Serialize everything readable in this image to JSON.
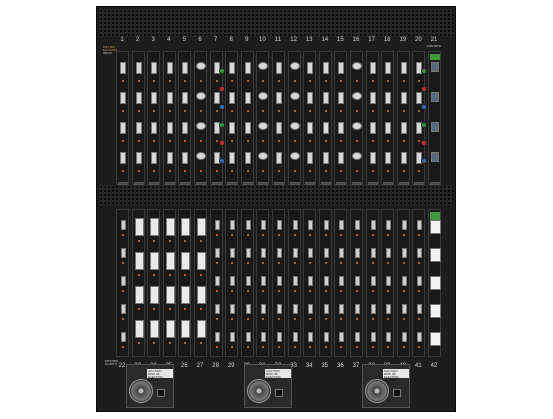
{
  "chassis": {
    "title_lines": [
      "MATRIX",
      "MTX2000"
    ],
    "top_section_label": "INPUT",
    "bottom_section_label": "OUTPUT",
    "top_slots": [
      "1",
      "2",
      "3",
      "4",
      "5",
      "6",
      "7",
      "8",
      "9",
      "10",
      "11",
      "12",
      "13",
      "14",
      "15",
      "16",
      "17",
      "18",
      "19",
      "20",
      "21"
    ],
    "top_slot_caption": "CONTROL",
    "bottom_slots": [
      "22",
      "23",
      "24",
      "25",
      "26",
      "27",
      "28",
      "29",
      "30",
      "31",
      "32",
      "33",
      "34",
      "35",
      "36",
      "37",
      "38",
      "39",
      "40",
      "41",
      "42"
    ]
  },
  "power_supplies": [
    {
      "caution_title": "CAUTION",
      "caution_text": "RISK OF ELECTRIC SHOCK"
    },
    {
      "caution_title": "CAUTION",
      "caution_text": "RISK OF ELECTRIC SHOCK"
    },
    {
      "caution_title": "CAUTION",
      "caution_text": "RISK OF ELECTRIC SHOCK"
    }
  ],
  "colors": {
    "chassis": "#1d1d1d",
    "label": "#c9a25a",
    "led": "#e0831a"
  }
}
